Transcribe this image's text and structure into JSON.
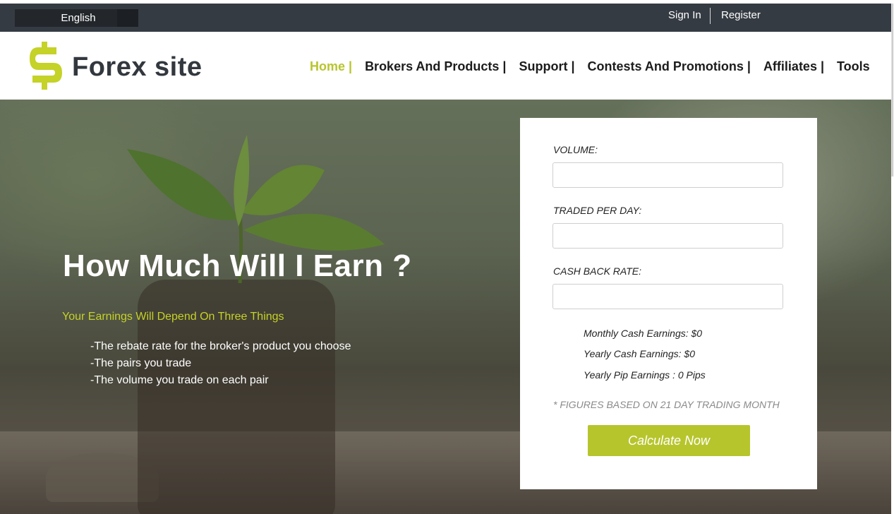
{
  "topbar": {
    "language": "English",
    "sign_in": "Sign In",
    "register": "Register"
  },
  "header": {
    "logo_text": "Forex site",
    "nav": [
      {
        "label": "Home |",
        "active": true
      },
      {
        "label": "Brokers And Products |"
      },
      {
        "label": "Support |"
      },
      {
        "label": "Contests And Promotions |"
      },
      {
        "label": "Affiliates |"
      },
      {
        "label": "Tools"
      }
    ]
  },
  "hero": {
    "title": "How Much Will I Earn ?",
    "subtitle": "Your Earnings Will Depend On Three Things",
    "points": [
      "-The rebate rate for the broker's product you choose",
      "-The pairs you trade",
      "-The volume you trade on each pair"
    ]
  },
  "calculator": {
    "volume_label": "VOLUME:",
    "volume_value": "",
    "traded_label": "TRADED PER DAY:",
    "traded_value": "",
    "cashback_label": "CASH BACK RATE:",
    "cashback_value": "",
    "monthly_earnings": "Monthly Cash Earnings: $0",
    "yearly_earnings": "Yearly Cash Earnings: $0",
    "yearly_pips": "Yearly Pip Earnings : 0 Pips",
    "note": "* FIGURES BASED ON 21 DAY TRADING MONTH",
    "button": "Calculate Now"
  },
  "colors": {
    "accent": "#b8c52e",
    "topbar": "#353b43",
    "logo_text": "#33383f"
  }
}
